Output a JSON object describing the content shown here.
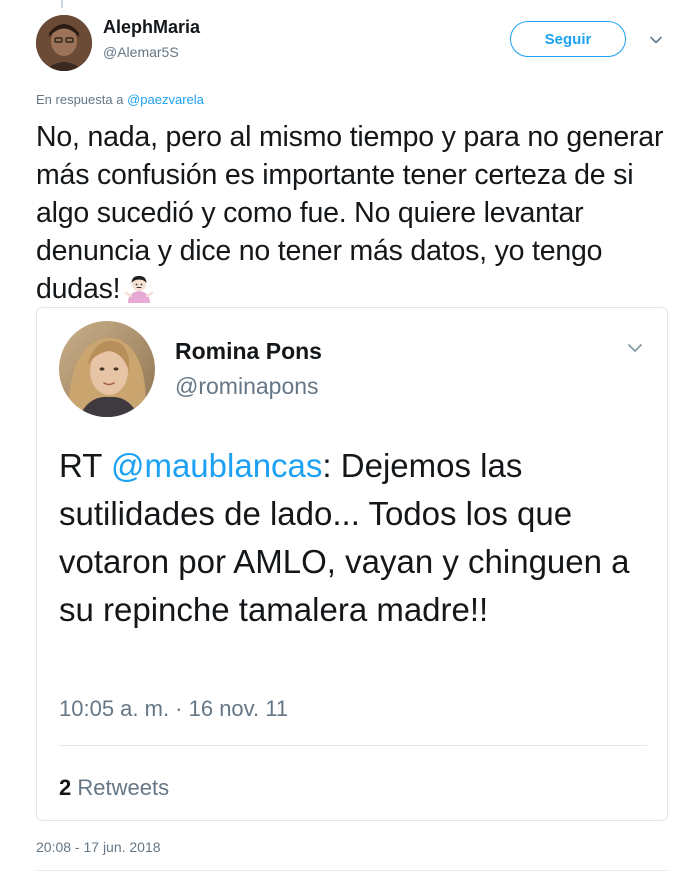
{
  "tweet": {
    "author": {
      "name": "AlephMaria",
      "handle": "@Alemar5S",
      "avatar_icon": "user-photo-avatar"
    },
    "follow_button_label": "Seguir",
    "reply_context": {
      "prefix": "En respuesta a",
      "mention": "@paezvarela"
    },
    "text": "No, nada, pero al mismo tiempo y para no generar más confusión es importante tener certeza de si algo sucedió y como fue. No quiere levantar denuncia y dice no tener más datos, yo tengo dudas!",
    "emoji_icon": "person-shrugging-emoji",
    "timestamp": "20:08 - 17 jun. 2018",
    "quoted": {
      "author": {
        "name": "Romina Pons",
        "handle": "@rominapons",
        "avatar_icon": "user-photo-avatar"
      },
      "text_prefix": "RT",
      "mention": "@maublancas",
      "text": ": Dejemos las sutilidades de lado... Todos los que votaron por AMLO, vayan y chinguen a su repinche tamalera madre!!",
      "time": "10:05 a. m. · 16 nov. 11",
      "retweet_count": "2",
      "retweet_label": "Retweets"
    }
  },
  "colors": {
    "accent": "#1da1f2",
    "secondary_text": "#657786",
    "primary_text": "#14171a",
    "border": "#e1e8ed"
  }
}
